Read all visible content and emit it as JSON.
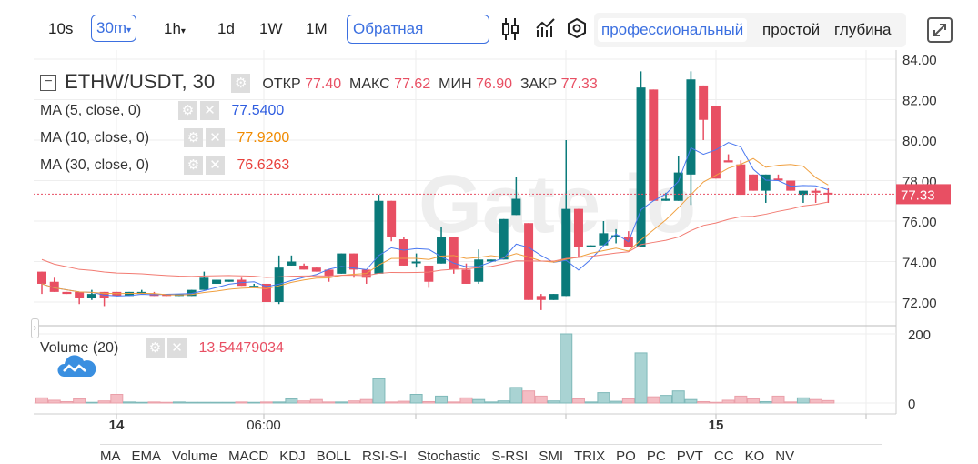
{
  "toolbar": {
    "intervals": [
      "10s",
      "30m",
      "1h",
      "1d",
      "1W",
      "1M"
    ],
    "selected_interval": "30m",
    "dropdown_marker": "▾",
    "search_value": "Обратная",
    "modes": [
      "профессиональный",
      "простой",
      "глубина"
    ],
    "active_mode": "профессиональный",
    "icons": [
      "candle-type-icon",
      "indicators-icon",
      "settings-icon",
      "fullscreen-icon"
    ]
  },
  "header": {
    "symbol": "ETHW/USDT, 30",
    "open_label": "ОТКР",
    "open": "77.40",
    "high_label": "МАКС",
    "high": "77.62",
    "low_label": "МИН",
    "low": "76.90",
    "close_label": "ЗАКР",
    "close": "77.33"
  },
  "ma": [
    {
      "label": "MA (5, close, 0)",
      "value": "77.5400",
      "color": "#2f5de0"
    },
    {
      "label": "MA (10, close, 0)",
      "value": "77.9200",
      "color": "#f08a00"
    },
    {
      "label": "MA (30, close, 0)",
      "value": "76.6263",
      "color": "#e8413c"
    }
  ],
  "volume": {
    "label": "Volume (20)",
    "value": "13.54479034"
  },
  "watermark": "Gate.io",
  "price_axis": [
    "84.00",
    "82.00",
    "80.00",
    "78.00",
    "76.00",
    "74.00",
    "72.00"
  ],
  "volume_axis": [
    "200",
    "0"
  ],
  "current_price": "77.33",
  "time_axis": [
    "14",
    "06:00",
    "15"
  ],
  "indicators": [
    "MA",
    "EMA",
    "Volume",
    "MACD",
    "KDJ",
    "BOLL",
    "RSI-S-I",
    "Stochastic",
    "S-RSI",
    "SMI",
    "TRIX",
    "PO",
    "PC",
    "PVT",
    "CC",
    "KO",
    "NV"
  ],
  "colors": {
    "up": "#0a7a7a",
    "down": "#e84f63",
    "accent": "#3b6fe0"
  },
  "chart_data": {
    "type": "candlestick",
    "ylim": [
      71,
      84.5
    ],
    "vlim": [
      0,
      200
    ],
    "ohlc": [
      [
        73.5,
        73.5,
        72.4,
        72.9
      ],
      [
        73.0,
        73.2,
        72.5,
        72.5
      ],
      [
        72.5,
        72.5,
        72.4,
        72.4
      ],
      [
        72.5,
        72.5,
        71.9,
        72.2
      ],
      [
        72.2,
        72.6,
        72.1,
        72.4
      ],
      [
        72.5,
        72.5,
        71.8,
        72.2
      ],
      [
        72.5,
        72.5,
        72.3,
        72.3
      ],
      [
        72.3,
        72.5,
        72.3,
        72.5
      ],
      [
        72.4,
        72.6,
        72.4,
        72.5
      ],
      [
        72.4,
        72.5,
        72.3,
        72.3
      ],
      [
        72.4,
        72.4,
        72.3,
        72.3
      ],
      [
        72.3,
        72.4,
        72.3,
        72.4
      ],
      [
        72.3,
        72.6,
        72.3,
        72.6
      ],
      [
        72.6,
        73.5,
        72.6,
        73.2
      ],
      [
        72.9,
        73.1,
        72.9,
        73.1
      ],
      [
        73.0,
        73.1,
        73.0,
        73.1
      ],
      [
        73.1,
        73.2,
        72.8,
        72.8
      ],
      [
        72.8,
        72.9,
        72.8,
        72.8
      ],
      [
        72.9,
        72.9,
        72.0,
        72.0
      ],
      [
        72.0,
        74.3,
        71.9,
        73.7
      ],
      [
        73.8,
        74.3,
        73.8,
        74.0
      ],
      [
        73.8,
        73.9,
        73.6,
        73.6
      ],
      [
        73.7,
        73.7,
        73.5,
        73.5
      ],
      [
        73.6,
        73.6,
        73.0,
        73.3
      ],
      [
        73.4,
        74.4,
        73.4,
        74.4
      ],
      [
        74.4,
        74.4,
        73.2,
        73.6
      ],
      [
        73.6,
        73.6,
        72.9,
        73.2
      ],
      [
        73.4,
        77.3,
        73.4,
        77.0
      ],
      [
        77.0,
        77.0,
        75.0,
        75.2
      ],
      [
        75.1,
        75.2,
        73.8,
        73.8
      ],
      [
        74.0,
        74.4,
        73.7,
        74.0
      ],
      [
        73.8,
        73.8,
        72.7,
        73.0
      ],
      [
        73.9,
        75.7,
        73.9,
        75.2
      ],
      [
        75.2,
        75.2,
        73.4,
        73.6
      ],
      [
        73.6,
        73.9,
        72.9,
        72.9
      ],
      [
        73.0,
        74.6,
        72.9,
        74.1
      ],
      [
        74.0,
        74.1,
        74.0,
        74.1
      ],
      [
        74.1,
        76.1,
        74.1,
        76.1
      ],
      [
        76.3,
        78.2,
        76.3,
        77.1
      ],
      [
        75.9,
        75.9,
        72.1,
        72.1
      ],
      [
        72.3,
        72.4,
        71.6,
        72.1
      ],
      [
        72.1,
        72.4,
        72.1,
        72.4
      ],
      [
        72.3,
        80.0,
        72.3,
        76.6
      ],
      [
        76.6,
        76.6,
        74.2,
        74.7
      ],
      [
        74.7,
        74.8,
        74.7,
        74.8
      ],
      [
        74.8,
        76.0,
        74.8,
        75.4
      ],
      [
        75.2,
        75.6,
        74.9,
        75.3
      ],
      [
        75.2,
        75.5,
        74.7,
        74.7
      ],
      [
        74.7,
        83.4,
        74.7,
        82.6
      ],
      [
        82.5,
        82.5,
        77.0,
        77.0
      ],
      [
        77.0,
        77.4,
        77.0,
        77.1
      ],
      [
        77.0,
        79.2,
        77.0,
        78.4
      ],
      [
        78.3,
        83.4,
        76.8,
        83.0
      ],
      [
        82.7,
        82.7,
        80.0,
        81.0
      ],
      [
        81.7,
        81.7,
        78.1,
        78.1
      ],
      [
        79.0,
        79.3,
        78.9,
        78.9
      ],
      [
        78.8,
        79.0,
        77.3,
        77.3
      ],
      [
        78.3,
        78.3,
        77.5,
        77.5
      ],
      [
        77.5,
        78.3,
        76.9,
        78.3
      ],
      [
        78.1,
        78.3,
        78.0,
        78.0
      ],
      [
        78.0,
        78.0,
        77.5,
        77.5
      ],
      [
        77.3,
        77.5,
        76.9,
        77.5
      ],
      [
        77.5,
        77.6,
        76.9,
        77.4
      ],
      [
        77.4,
        77.62,
        76.9,
        77.33
      ]
    ],
    "vol": [
      15,
      8,
      4,
      12,
      2,
      6,
      25,
      3,
      2,
      3,
      2,
      3,
      2,
      2,
      2,
      2,
      3,
      2,
      3,
      3,
      12,
      6,
      10,
      3,
      3,
      6,
      10,
      70,
      3,
      5,
      25,
      4,
      20,
      3,
      15,
      10,
      3,
      6,
      45,
      35,
      20,
      6,
      200,
      12,
      3,
      30,
      5,
      12,
      145,
      18,
      22,
      35,
      10,
      4,
      2,
      8,
      20,
      12,
      4,
      20,
      3,
      15,
      10,
      7
    ]
  }
}
